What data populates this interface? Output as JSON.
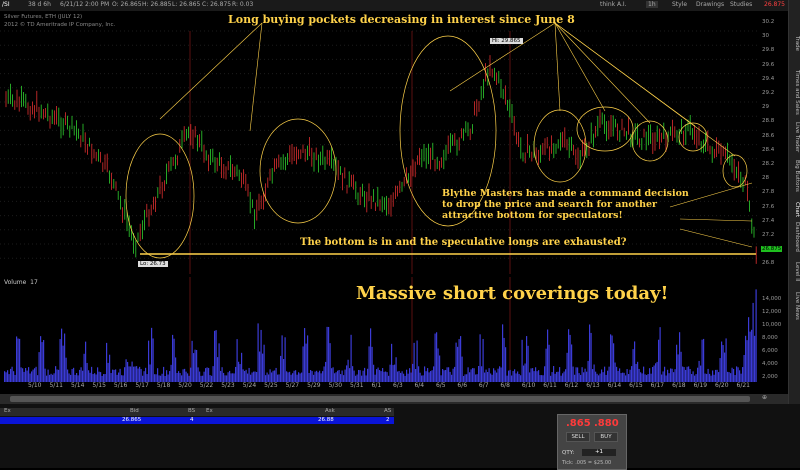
{
  "toolbar": {
    "symbol": "/SI",
    "timeframe": "38 d 6h",
    "date": "6/21/12 2:00 PM",
    "open": "O: 26.865",
    "high": "H: 26.885",
    "low": "L: 26.865",
    "close": "C: 26.875",
    "range": "R: 0.03",
    "think_label": "think A.I.",
    "zoom": "1h",
    "style_label": "Style",
    "drawings_label": "Drawings",
    "studies_label": "Studies",
    "price_badge": "26.875"
  },
  "chart": {
    "instrument_title": "Silver Futures, ETH (JULY 12)",
    "copyright": "2012 © TD Ameritrade IP Company, Inc.",
    "hi_label": "Hi: 29.865",
    "lo_label": "Lo: 26.73",
    "last_price_badge": "26.875",
    "volume_label": "Volume",
    "volume_value": "17",
    "annotations": {
      "headline": "Long buying pockets decreasing in interest since June 8",
      "blythe_line1": "Blythe Masters has made a command decision",
      "blythe_line2": "to drop the price and search for another",
      "blythe_line3": "attractive bottom for speculators!",
      "bottom_note": "The bottom is in and the speculative longs are exhausted?",
      "short_cover": "Massive short coverings today!"
    },
    "price_axis": [
      "30.2",
      "30",
      "29.8",
      "29.6",
      "29.4",
      "29.2",
      "29",
      "28.8",
      "28.6",
      "28.4",
      "28.2",
      "28",
      "27.8",
      "27.6",
      "27.4",
      "27.2",
      "27",
      "26.8"
    ],
    "volume_axis": [
      "14,000",
      "12,000",
      "10,000",
      "8,000",
      "6,000",
      "4,000",
      "2,000"
    ],
    "dates": [
      "5/10",
      "5/11",
      "5/14",
      "5/15",
      "5/16",
      "5/17",
      "5/18",
      "5/20",
      "5/22",
      "5/23",
      "5/24",
      "5/25",
      "5/27",
      "5/29",
      "5/30",
      "5/31",
      "6/1",
      "6/3",
      "6/4",
      "6/5",
      "6/6",
      "6/7",
      "6/8",
      "6/10",
      "6/11",
      "6/12",
      "6/13",
      "6/14",
      "6/15",
      "6/17",
      "6/18",
      "6/19",
      "6/20",
      "6/21"
    ]
  },
  "side_tabs": [
    "Trade",
    "Times and Sales",
    "Live Trader",
    "Big Buttons",
    "Chart",
    "Dashboard",
    "Level II",
    "Live News"
  ],
  "order_table": {
    "headers": [
      "Ex",
      "Bid",
      "BS",
      "Ex",
      "Ask",
      "AS"
    ],
    "row": [
      "",
      "26.865",
      "4",
      "",
      "26.88",
      "2"
    ]
  },
  "trade_panel": {
    "bid_price": ".865",
    "ask_price": ".880",
    "sell_label": "SELL",
    "buy_label": "BUY",
    "qty_label": "QTY:",
    "qty_value": "+1",
    "footer": "Tick: .005 = $25.00"
  },
  "colors": {
    "up": "#2fd12f",
    "down": "#e03030",
    "annotation": "#ffd24a",
    "volume": "#3b3bd6",
    "selected_row": "#0a14d8"
  }
}
